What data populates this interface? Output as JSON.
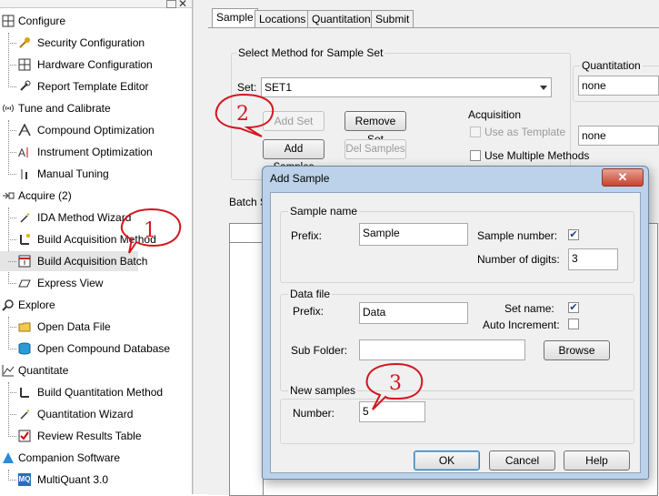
{
  "sidebar": {
    "sections": [
      {
        "label": "Configure",
        "icon": "grid-icon",
        "items": [
          {
            "label": "Security Configuration",
            "icon": "key-icon"
          },
          {
            "label": "Hardware Configuration",
            "icon": "grid-icon"
          },
          {
            "label": "Report Template Editor",
            "icon": "wrench-icon"
          }
        ]
      },
      {
        "label": "Tune and Calibrate",
        "icon": "signal-icon",
        "items": [
          {
            "label": "Compound Optimization",
            "icon": "peak-icon"
          },
          {
            "label": "Instrument Optimization",
            "icon": "ai-icon"
          },
          {
            "label": "Manual Tuning",
            "icon": "tuning-icon"
          }
        ]
      },
      {
        "label": "Acquire  (2)",
        "icon": "acquire-icon",
        "items": [
          {
            "label": "IDA Method Wizard",
            "icon": "wand-icon"
          },
          {
            "label": "Build Acquisition Method",
            "icon": "build-method-icon"
          },
          {
            "label": "Build Acquisition Batch",
            "icon": "batch-icon"
          },
          {
            "label": "Express View",
            "icon": "express-icon"
          }
        ]
      },
      {
        "label": "Explore",
        "icon": "explore-icon",
        "items": [
          {
            "label": "Open Data File",
            "icon": "folder-icon"
          },
          {
            "label": "Open Compound Database",
            "icon": "database-icon"
          }
        ]
      },
      {
        "label": "Quantitate",
        "icon": "chart-icon",
        "items": [
          {
            "label": "Build Quantitation Method",
            "icon": "quant-method-icon"
          },
          {
            "label": "Quantitation Wizard",
            "icon": "wand-icon"
          },
          {
            "label": "Review Results Table",
            "icon": "check-table-icon"
          }
        ]
      },
      {
        "label": "Companion Software",
        "icon": "companion-icon",
        "items": [
          {
            "label": "MultiQuant 3.0",
            "icon": "mq-icon"
          }
        ]
      }
    ],
    "mq_icon_text": "MQ"
  },
  "tabs": [
    "Sample",
    "Locations",
    "Quantitation",
    "Submit"
  ],
  "method_group": {
    "title": "Select Method for Sample Set",
    "set_label": "Set:",
    "set_value": "SET1",
    "buttons": {
      "add_set": "Add Set",
      "remove_set": "Remove Set",
      "add_samples": "Add Samples",
      "del_samples": "Del Samples"
    }
  },
  "quantitation_group": {
    "title": "Quantitation",
    "value": "none"
  },
  "acquisition_group": {
    "title": "Acquisition",
    "use_as_template": "Use as Template",
    "template_value": "none",
    "use_multiple_methods": "Use Multiple Methods"
  },
  "batch_label": "Batch S",
  "dialog": {
    "title": "Add Sample",
    "close": "✕",
    "sample_name": {
      "title": "Sample name",
      "prefix_label": "Prefix:",
      "prefix_value": "Sample",
      "sample_number_label": "Sample number:",
      "sample_number_checked": true,
      "digits_label": "Number of digits:",
      "digits_value": "3"
    },
    "data_file": {
      "title": "Data file",
      "prefix_label": "Prefix:",
      "prefix_value": "Data",
      "set_name_label": "Set name:",
      "set_name_checked": true,
      "auto_increment_label": "Auto Increment:",
      "auto_increment_checked": false,
      "subfolder_label": "Sub Folder:",
      "subfolder_value": "",
      "browse": "Browse"
    },
    "new_samples": {
      "title": "New samples",
      "number_label": "Number:",
      "number_value": "5"
    },
    "ok": "OK",
    "cancel": "Cancel",
    "help": "Help"
  },
  "callouts": [
    "1",
    "2",
    "3"
  ],
  "colors": {
    "callout_red": "#d2171f",
    "selection": "#e5e5e5",
    "dialog_frame": "#bcd2ea"
  }
}
